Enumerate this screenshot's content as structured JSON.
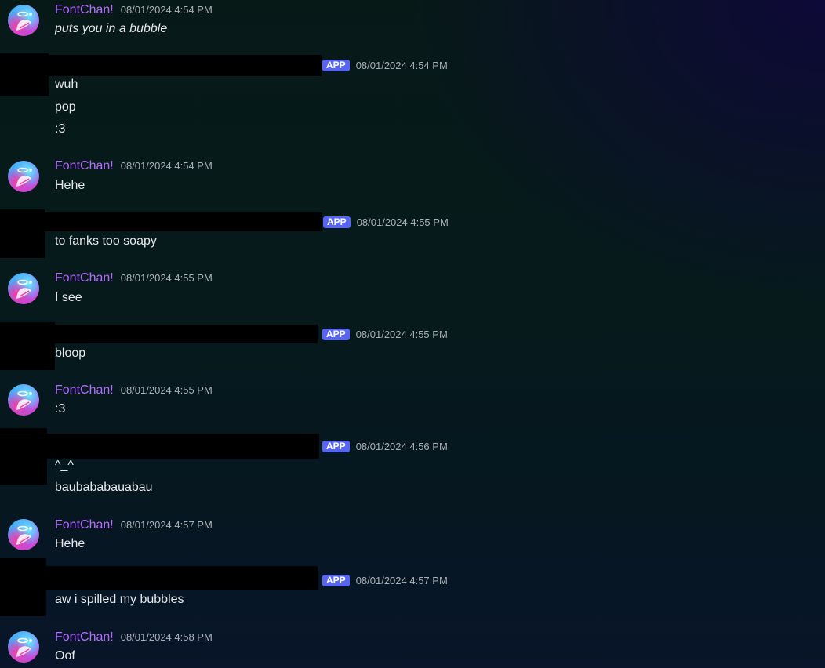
{
  "colors": {
    "username": "#b46cff",
    "timestamp": "#a9b0b6",
    "message_text": "#e6e8ea",
    "app_badge": "#5865f2",
    "redaction": "#000000",
    "background": "#071917"
  },
  "badge_label": "APP",
  "messages": [
    {
      "author": "FontChan!",
      "timestamp": "08/01/2024 4:54 PM",
      "lines": [
        "puts you in a bubble"
      ],
      "style": "italic"
    },
    {
      "author_redacted": true,
      "timestamp": "08/01/2024 4:54 PM",
      "lines": [
        "wuh",
        "pop",
        ":3"
      ]
    },
    {
      "author": "FontChan!",
      "timestamp": "08/01/2024 4:54 PM",
      "lines": [
        "Hehe"
      ]
    },
    {
      "author_redacted": true,
      "timestamp": "08/01/2024 4:55 PM",
      "lines": [
        "to fanks too soapy"
      ]
    },
    {
      "author": "FontChan!",
      "timestamp": "08/01/2024 4:55 PM",
      "lines": [
        "I see"
      ]
    },
    {
      "author_redacted": true,
      "timestamp": "08/01/2024 4:55 PM",
      "lines": [
        "bloop"
      ]
    },
    {
      "author": "FontChan!",
      "timestamp": "08/01/2024 4:55 PM",
      "lines": [
        ":3"
      ]
    },
    {
      "author_redacted": true,
      "timestamp": "08/01/2024 4:56 PM",
      "lines": [
        "^_^",
        "baubababauabau"
      ]
    },
    {
      "author": "FontChan!",
      "timestamp": "08/01/2024 4:57 PM",
      "lines": [
        "Hehe"
      ]
    },
    {
      "author_redacted": true,
      "timestamp": "08/01/2024 4:57 PM",
      "lines": [
        "aw i spilled my bubbles"
      ]
    },
    {
      "author": "FontChan!",
      "timestamp": "08/01/2024 4:58 PM",
      "lines": [
        "Oof"
      ]
    }
  ]
}
